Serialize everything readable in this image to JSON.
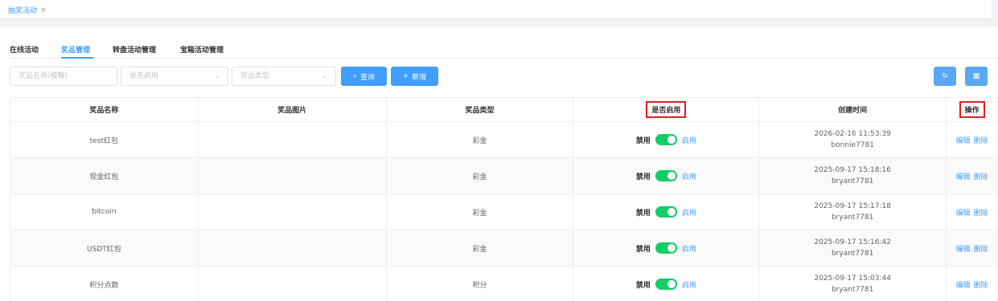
{
  "page_tab": {
    "label": "抽奖活动",
    "close": "×"
  },
  "tabs": [
    {
      "label": "在线活动"
    },
    {
      "label": "奖品管理"
    },
    {
      "label": "转盘活动管理"
    },
    {
      "label": "宝箱活动管理"
    }
  ],
  "filters": {
    "name_placeholder": "奖品名称(模糊)",
    "enabled_placeholder": "是否启用",
    "type_placeholder": "奖品类型"
  },
  "buttons": {
    "search": "查询",
    "search_icon": "⌕",
    "add": "新增",
    "add_icon": "+",
    "refresh_icon": "↻",
    "grid_icon": "▦"
  },
  "table": {
    "headers": [
      "奖品名称",
      "奖品图片",
      "奖品类型",
      "是否启用",
      "创建时间",
      "操作"
    ],
    "rows": [
      {
        "name": "test红包",
        "image": "",
        "type": "彩金",
        "off": "禁用",
        "on": "启用",
        "time": "2026-02-16 11:53:39",
        "user": "bonnie7781",
        "edit": "编辑",
        "delete": "删除"
      },
      {
        "name": "现金红包",
        "image": "",
        "type": "彩金",
        "off": "禁用",
        "on": "启用",
        "time": "2025-09-17 15:18:16",
        "user": "bryant7781",
        "edit": "编辑",
        "delete": "删除"
      },
      {
        "name": "bitcoin",
        "image": "",
        "type": "彩金",
        "off": "禁用",
        "on": "启用",
        "time": "2025-09-17 15:17:18",
        "user": "bryant7781",
        "edit": "编辑",
        "delete": "删除"
      },
      {
        "name": "USDT红包",
        "image": "",
        "type": "彩金",
        "off": "禁用",
        "on": "启用",
        "time": "2025-09-17 15:16:42",
        "user": "bryant7781",
        "edit": "编辑",
        "delete": "删除"
      },
      {
        "name": "积分点数",
        "image": "",
        "type": "积分",
        "off": "禁用",
        "on": "启用",
        "time": "2025-09-17 15:03:44",
        "user": "bryant7781",
        "edit": "编辑",
        "delete": "删除"
      }
    ]
  },
  "colors": {
    "accent": "#409eff",
    "switch_on": "#13ce66",
    "highlight": "#e01e1e"
  }
}
